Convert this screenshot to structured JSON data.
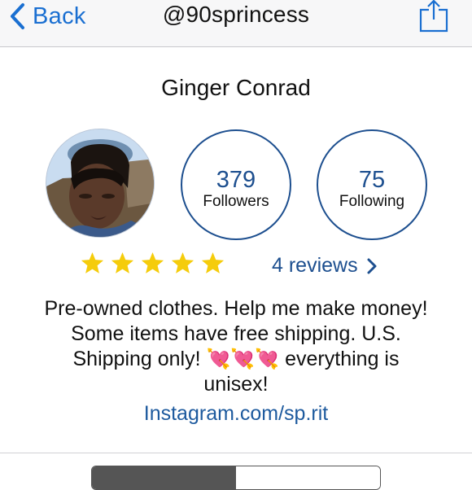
{
  "navbar": {
    "back_label": "Back",
    "title": "@90sprincess",
    "share_icon": "share-icon"
  },
  "profile": {
    "name": "Ginger Conrad",
    "avatar": "avatar-photo"
  },
  "stats": {
    "followers": {
      "count": "379",
      "label": "Followers"
    },
    "following": {
      "count": "75",
      "label": "Following"
    }
  },
  "rating": {
    "stars": 5,
    "max_stars": 5,
    "reviews_label": "4 reviews"
  },
  "bio": {
    "line1": "Pre-owned clothes. Help me make money!",
    "line2": "Some items have free shipping. U.S.",
    "line3_before": "Shipping only!",
    "hearts": "💘💘💘",
    "line3_after": "everything is",
    "line4": "unisex!"
  },
  "link": {
    "text": "Instagram.com/sp.rit"
  },
  "segmented": {
    "left": "",
    "right": ""
  },
  "colors": {
    "ios_blue": "#1a6fd1",
    "stat_blue": "#1d4f8f",
    "star_gold": "#f5cc0b",
    "heart_pink": "#e0287a"
  }
}
